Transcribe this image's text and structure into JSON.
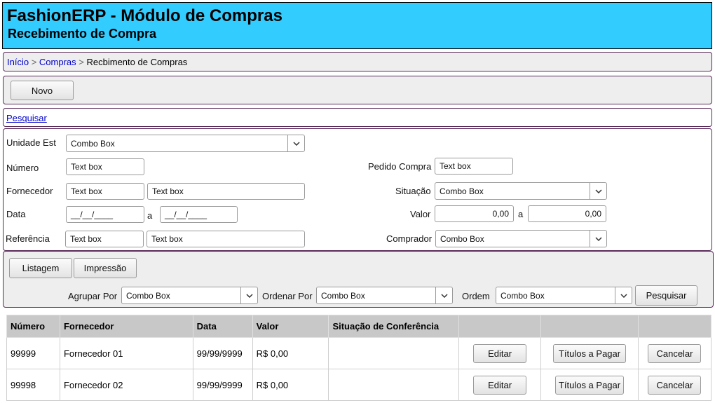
{
  "header": {
    "title": "FashionERP - Módulo de Compras",
    "subtitle": "Recebimento de Compra"
  },
  "breadcrumb": {
    "items": [
      "Início",
      "Compras",
      "Recbimento de Compras"
    ],
    "separator": ">"
  },
  "toolbar": {
    "novo_label": "Novo"
  },
  "search_link": "Pesquisar",
  "form": {
    "unidade_label": "Unidade Est",
    "unidade_value": "Combo Box",
    "numero_label": "Número",
    "numero_value": "Text box",
    "fornecedor_label": "Fornecedor",
    "fornecedor_value1": "Text box",
    "fornecedor_value2": "Text box",
    "data_label": "Data",
    "data_from": "__/__/____",
    "data_sep": "a",
    "data_to": "__/__/____",
    "referencia_label": "Referência",
    "referencia_value1": "Text box",
    "referencia_value2": "Text box",
    "pedido_label": "Pedido Compra",
    "pedido_value": "Text box",
    "situacao_label": "Situação",
    "situacao_value": "Combo Box",
    "valor_label": "Valor",
    "valor_from": "0,00",
    "valor_sep": "a",
    "valor_to": "0,00",
    "comprador_label": "Comprador",
    "comprador_value": "Combo Box"
  },
  "actions": {
    "listagem_label": "Listagem",
    "impressao_label": "Impressão",
    "agrupar_label": "Agrupar Por",
    "agrupar_value": "Combo Box",
    "ordenar_label": "Ordenar Por",
    "ordenar_value": "Combo Box",
    "ordem_label": "Ordem",
    "ordem_value": "Combo Box",
    "pesquisar_label": "Pesquisar"
  },
  "table": {
    "headers": [
      "Número",
      "Fornecedor",
      "Data",
      "Valor",
      "Situação de Conferência",
      "",
      "",
      ""
    ],
    "rows": [
      {
        "numero": "99999",
        "fornecedor": "Fornecedor 01",
        "data": "99/99/9999",
        "valor": "R$ 0,00",
        "situacao": "",
        "editar": "Editar",
        "titulos": "Títulos a Pagar",
        "cancelar": "Cancelar"
      },
      {
        "numero": "99998",
        "fornecedor": "Fornecedor 02",
        "data": "99/99/9999",
        "valor": "R$ 0,00",
        "situacao": "",
        "editar": "Editar",
        "titulos": "Títulos a Pagar",
        "cancelar": "Cancelar"
      }
    ]
  }
}
